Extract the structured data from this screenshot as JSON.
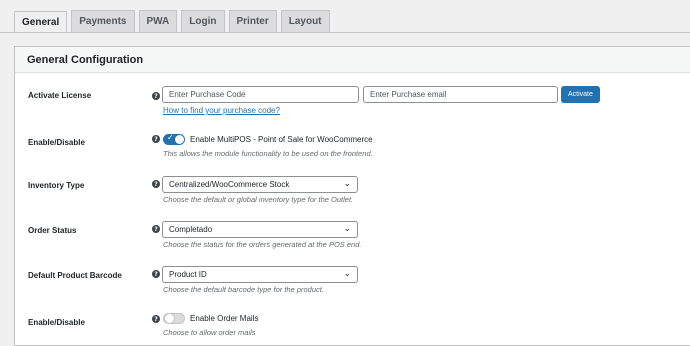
{
  "tabs": [
    "General",
    "Payments",
    "PWA",
    "Login",
    "Printer",
    "Layout"
  ],
  "section_title": "General Configuration",
  "license": {
    "label": "Activate License",
    "code_placeholder": "Enter Purchase Code",
    "email_placeholder": "Enter Purchase email",
    "button": "Activate",
    "help_link": "How to find your purchase code?"
  },
  "enable": {
    "label": "Enable/Disable",
    "toggle_label": "Enable MultiPOS - Point of Sale for WooCommerce",
    "description": "This allows the module functionality to be used on the frontend.",
    "state": "on"
  },
  "inventory": {
    "label": "Inventory Type",
    "value": "Centralized/WooCommerce Stock",
    "description": "Choose the default or global inventory type for the Outlet."
  },
  "order_status": {
    "label": "Order Status",
    "value": "Completado",
    "description": "Choose the status for the orders generated at the POS end."
  },
  "barcode": {
    "label": "Default Product Barcode",
    "value": "Product ID",
    "description": "Choose the default barcode type for the product."
  },
  "mails": {
    "label": "Enable/Disable",
    "toggle_label": "Enable Order Mails",
    "description": "Choose to allow order mails",
    "state": "off"
  },
  "help_glyph": "?",
  "chevron_glyph": "⌄",
  "check_glyph": "✓",
  "colors": {
    "accent": "#2271b1",
    "background": "#f0f0f1",
    "card": "#ffffff"
  }
}
